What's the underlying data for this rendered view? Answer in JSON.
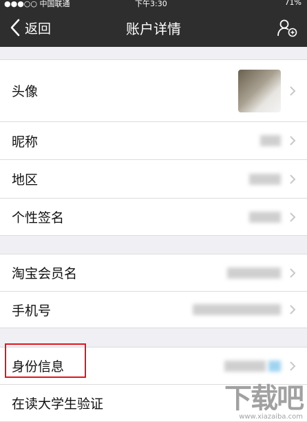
{
  "status_bar": {
    "carrier": "●●●○○ 中国联通",
    "time": "下午3:30",
    "battery": "71%"
  },
  "nav": {
    "back_label": "返回",
    "title": "账户详情"
  },
  "rows": {
    "avatar": {
      "label": "头像"
    },
    "nickname": {
      "label": "昵称"
    },
    "region": {
      "label": "地区"
    },
    "signature": {
      "label": "个性签名"
    },
    "taobao_member": {
      "label": "淘宝会员名"
    },
    "phone": {
      "label": "手机号"
    },
    "identity": {
      "label": "身份信息"
    },
    "student": {
      "label": "在读大学生验证"
    }
  },
  "highlight_color": "#e0141b",
  "watermark": {
    "brand": "下载吧",
    "url": "www.xiazaiba.com"
  }
}
